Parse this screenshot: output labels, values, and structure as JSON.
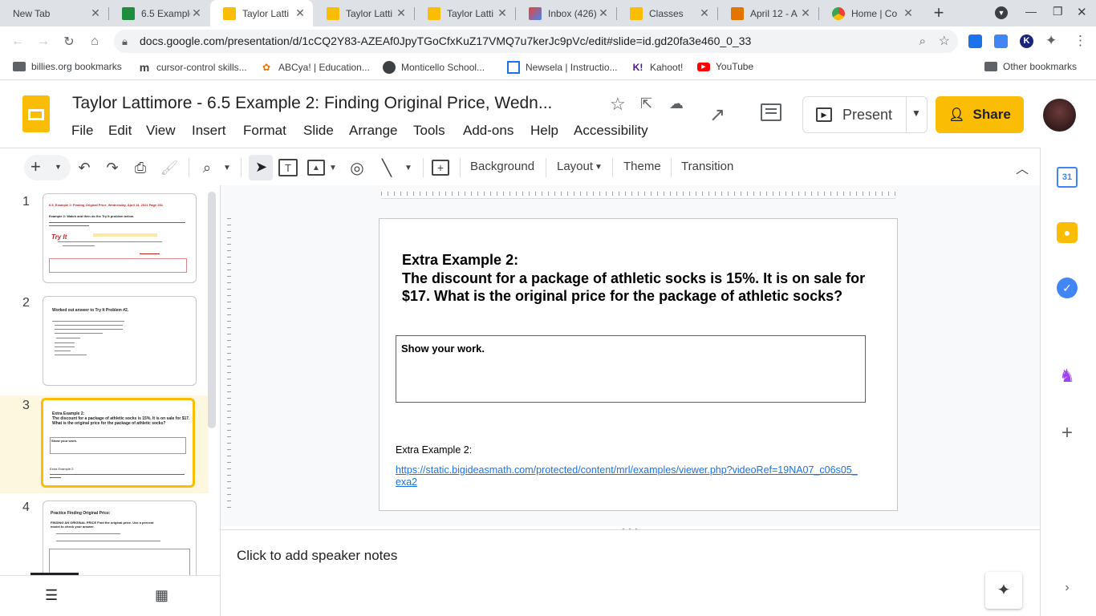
{
  "browser": {
    "tabs": [
      {
        "label": "New Tab",
        "icon": "none",
        "color": ""
      },
      {
        "label": "6.5 Example",
        "icon": "classroom",
        "color": "#1e8e3e"
      },
      {
        "label": "Taylor Latti",
        "icon": "slides",
        "color": "#fbbc04",
        "active": true
      },
      {
        "label": "Taylor Latti",
        "icon": "slides",
        "color": "#fbbc04"
      },
      {
        "label": "Taylor Latti",
        "icon": "slides",
        "color": "#fbbc04"
      },
      {
        "label": "Inbox (426)",
        "icon": "gmail",
        "color": "#ea4335"
      },
      {
        "label": "Classes",
        "icon": "classroom",
        "color": "#fbbc04"
      },
      {
        "label": "April 12 - A",
        "icon": "classroom",
        "color": "#e37400"
      },
      {
        "label": "Home | Co",
        "icon": "chrome",
        "color": "#4285f4"
      }
    ],
    "url": "docs.google.com/presentation/d/1cCQ2Y83-AZEAf0JpyTGoCfxKuZ17VMQ7u7kerJc9pVc/edit#slide=id.gd20fa3e460_0_33",
    "bookmarks": [
      {
        "label": "billies.org bookmarks",
        "icon": "folder-icon"
      },
      {
        "label": "cursor-control skills...",
        "icon": "m-icon"
      },
      {
        "label": "ABCya! | Education...",
        "icon": "abcya-icon"
      },
      {
        "label": "Monticello School...",
        "icon": "school-icon"
      },
      {
        "label": "Newsela | Instructio...",
        "icon": "newsela-icon"
      },
      {
        "label": "Kahoot!",
        "icon": "kahoot-icon"
      },
      {
        "label": "YouTube",
        "icon": "youtube-icon"
      }
    ],
    "other_bookmarks": "Other bookmarks"
  },
  "doc": {
    "title": "Taylor Lattimore - 6.5 Example 2:  Finding Original Price, Wedn...",
    "menus": [
      "File",
      "Edit",
      "View",
      "Insert",
      "Format",
      "Slide",
      "Arrange",
      "Tools",
      "Add-ons",
      "Help",
      "Accessibility"
    ],
    "present_label": "Present",
    "share_label": "Share"
  },
  "toolbar": {
    "background_label": "Background",
    "layout_label": "Layout",
    "theme_label": "Theme",
    "transition_label": "Transition"
  },
  "filmstrip": {
    "slides": [
      {
        "number": "1"
      },
      {
        "number": "2"
      },
      {
        "number": "3",
        "selected": true
      },
      {
        "number": "4"
      }
    ],
    "thumb1_title": "6.5, Example 2: Finding Original Price, Wednesday, April 14, 2021 Page 281",
    "thumb1_sub": "Example 2: Watch and then do the Try It problem below.",
    "thumb1_try": "Try It",
    "thumb2_title": "Worked out answer to Try It Problem #2.",
    "thumb3_title": "Extra Example 2:",
    "thumb3_body": "The discount for a package of athletic socks is 15%.  It is on sale for $17.  What is the original price for the package of athletic socks?",
    "thumb3_box": "Show your work.",
    "thumb3_foot": "Extra Example 2:",
    "thumb4_title": "Practice Finding Original Price:",
    "thumb4_sub": "FINDING AN ORIGINAL PRICE  Find the original price. Use a percent model to check your answer."
  },
  "slide": {
    "heading": "Extra Example 2:",
    "body": "The discount for a package of athletic socks is 15%.  It is on sale for $17.  What is the original price for the package of athletic socks?",
    "work_label": "Show your work.",
    "footer_label": "Extra Example 2:",
    "link": "https://static.bigideasmath.com/protected/content/mrl/examples/viewer.php?videoRef=19NA07_c06s05_exa2"
  },
  "notes": {
    "placeholder": "Click to add speaker notes"
  },
  "colors": {
    "accent": "#fbbc04",
    "link": "#1a73e8"
  }
}
